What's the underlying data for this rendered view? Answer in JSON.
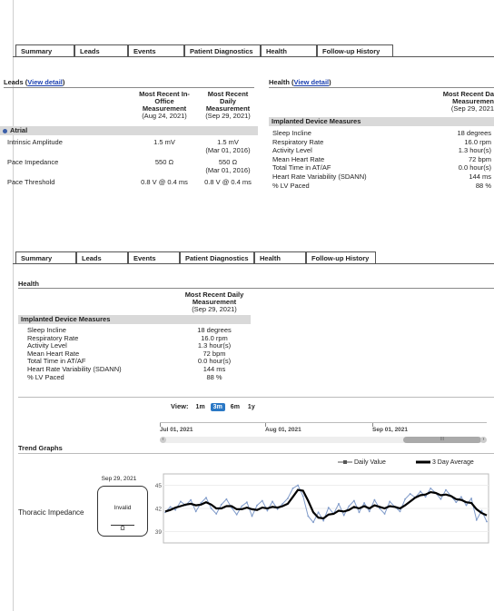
{
  "tabs_top": [
    "Summary",
    "Leads",
    "Events",
    "Patient Diagnostics",
    "Health",
    "Follow-up History"
  ],
  "tabs_bottom": [
    "Summary",
    "Leads",
    "Events",
    "Patient Diagnostics",
    "Health",
    "Follow-up History"
  ],
  "leads": {
    "title": "Leads (",
    "link": "View detail",
    "title_end": ")",
    "col1": {
      "l1": "Most Recent In-",
      "l2": "Office",
      "l3": "Measurement",
      "date": "(Aug 24, 2021)"
    },
    "col2": {
      "l1": "Most Recent",
      "l2": "Daily",
      "l3": "Measurement",
      "date": "(Sep 29, 2021)"
    },
    "group": "Atrial",
    "rows": [
      {
        "label": "Intrinsic Amplitude",
        "v1": "1.5 mV",
        "v2": "1.5 mV",
        "v2sub": "(Mar 01, 2016)"
      },
      {
        "label": "Pace Impedance",
        "v1": "550 Ω",
        "v2": "550 Ω",
        "v2sub": "(Mar 01, 2016)"
      },
      {
        "label": "Pace Threshold",
        "v1": "0.8 V @ 0.4 ms",
        "v2": "0.8 V @ 0.4 ms",
        "v2sub": ""
      }
    ]
  },
  "health_top": {
    "title": "Health (",
    "link": "View detail",
    "title_end": ")",
    "col": {
      "l1": "Most Recent Da",
      "l2": "Measuremen",
      "date": "(Sep 29, 2021"
    },
    "group": "Implanted Device Measures",
    "rows": [
      {
        "label": "Sleep Incline",
        "value": "18 degrees"
      },
      {
        "label": "Respiratory Rate",
        "value": "16.0 rpm"
      },
      {
        "label": "Activity Level",
        "value": "1.3 hour(s)"
      },
      {
        "label": "Mean Heart Rate",
        "value": "72 bpm"
      },
      {
        "label": "Total Time in AT/AF",
        "value": "0.0 hour(s)"
      },
      {
        "label": "Heart Rate Variability (SDANN)",
        "value": "144 ms"
      },
      {
        "label": "% LV Paced",
        "value": "88 %"
      }
    ]
  },
  "health_bottom": {
    "title": "Health",
    "col": {
      "l1": "Most Recent Daily",
      "l2": "Measurement",
      "date": "(Sep 29, 2021)"
    },
    "group": "Implanted Device Measures",
    "rows": [
      {
        "label": "Sleep Incline",
        "value": "18 degrees"
      },
      {
        "label": "Respiratory Rate",
        "value": "16.0 rpm"
      },
      {
        "label": "Activity Level",
        "value": "1.3 hour(s)"
      },
      {
        "label": "Mean Heart Rate",
        "value": "72 bpm"
      },
      {
        "label": "Total Time in AT/AF",
        "value": "0.0 hour(s)"
      },
      {
        "label": "Heart Rate Variability (SDANN)",
        "value": "144 ms"
      },
      {
        "label": "% LV Paced",
        "value": "88 %"
      }
    ]
  },
  "view": {
    "label": "View:",
    "options": [
      "1m",
      "3m",
      "6m",
      "1y"
    ],
    "selected": "3m"
  },
  "timeline": {
    "dates": [
      "Jul 01, 2021",
      "Aug 01, 2021",
      "Sep 01, 2021"
    ],
    "scroll_mark": "III"
  },
  "trend": {
    "title": "Trend Graphs",
    "legend_daily": "Daily Value",
    "legend_avg": "3 Day Average",
    "metric_label": "Thoracic Impedance",
    "card_date": "Sep 29, 2021",
    "card_status": "Invalid",
    "card_unit": "Ω",
    "yticks": [
      "45",
      "42",
      "39"
    ],
    "accent": "#2a78c5",
    "daily_color": "#7f9ac9"
  },
  "chart_data": {
    "type": "line",
    "ylim": [
      38,
      46
    ],
    "series": [
      {
        "name": "Daily Value",
        "values": [
          41.5,
          42.2,
          41.8,
          42.9,
          42.4,
          43.1,
          41.6,
          42.7,
          43.4,
          42.0,
          41.3,
          42.5,
          43.2,
          42.1,
          41.2,
          42.3,
          42.8,
          41.0,
          42.4,
          43.0,
          41.7,
          42.9,
          41.9,
          42.6,
          43.3,
          44.6,
          45.0,
          43.6,
          41.0,
          40.2,
          41.5,
          40.4,
          42.1,
          41.3,
          42.6,
          41.1,
          42.3,
          43.0,
          41.5,
          42.7,
          41.6,
          43.1,
          42.0,
          41.3,
          42.9,
          42.2,
          41.6,
          43.2,
          43.9,
          43.4,
          44.2,
          43.5,
          44.6,
          44.0,
          43.2,
          44.4,
          43.6,
          42.8,
          43.5,
          42.4,
          43.3,
          40.5,
          41.7,
          40.3
        ]
      },
      {
        "name": "3 Day Average",
        "values": [
          41.6,
          41.8,
          42.1,
          42.3,
          42.5,
          42.6,
          42.4,
          42.5,
          42.8,
          42.5,
          42.0,
          42.0,
          42.3,
          42.3,
          41.9,
          41.9,
          42.1,
          41.9,
          41.8,
          42.1,
          42.0,
          42.2,
          42.1,
          42.3,
          42.6,
          43.5,
          44.4,
          44.3,
          43.0,
          41.5,
          40.8,
          40.7,
          41.2,
          41.3,
          41.7,
          41.6,
          41.8,
          42.2,
          42.0,
          42.3,
          42.0,
          42.4,
          42.2,
          42.0,
          42.3,
          42.2,
          42.0,
          42.4,
          42.9,
          43.4,
          43.7,
          43.8,
          44.1,
          44.0,
          43.7,
          43.8,
          43.6,
          43.2,
          43.1,
          42.8,
          42.7,
          41.9,
          41.4,
          41.1
        ]
      }
    ]
  }
}
